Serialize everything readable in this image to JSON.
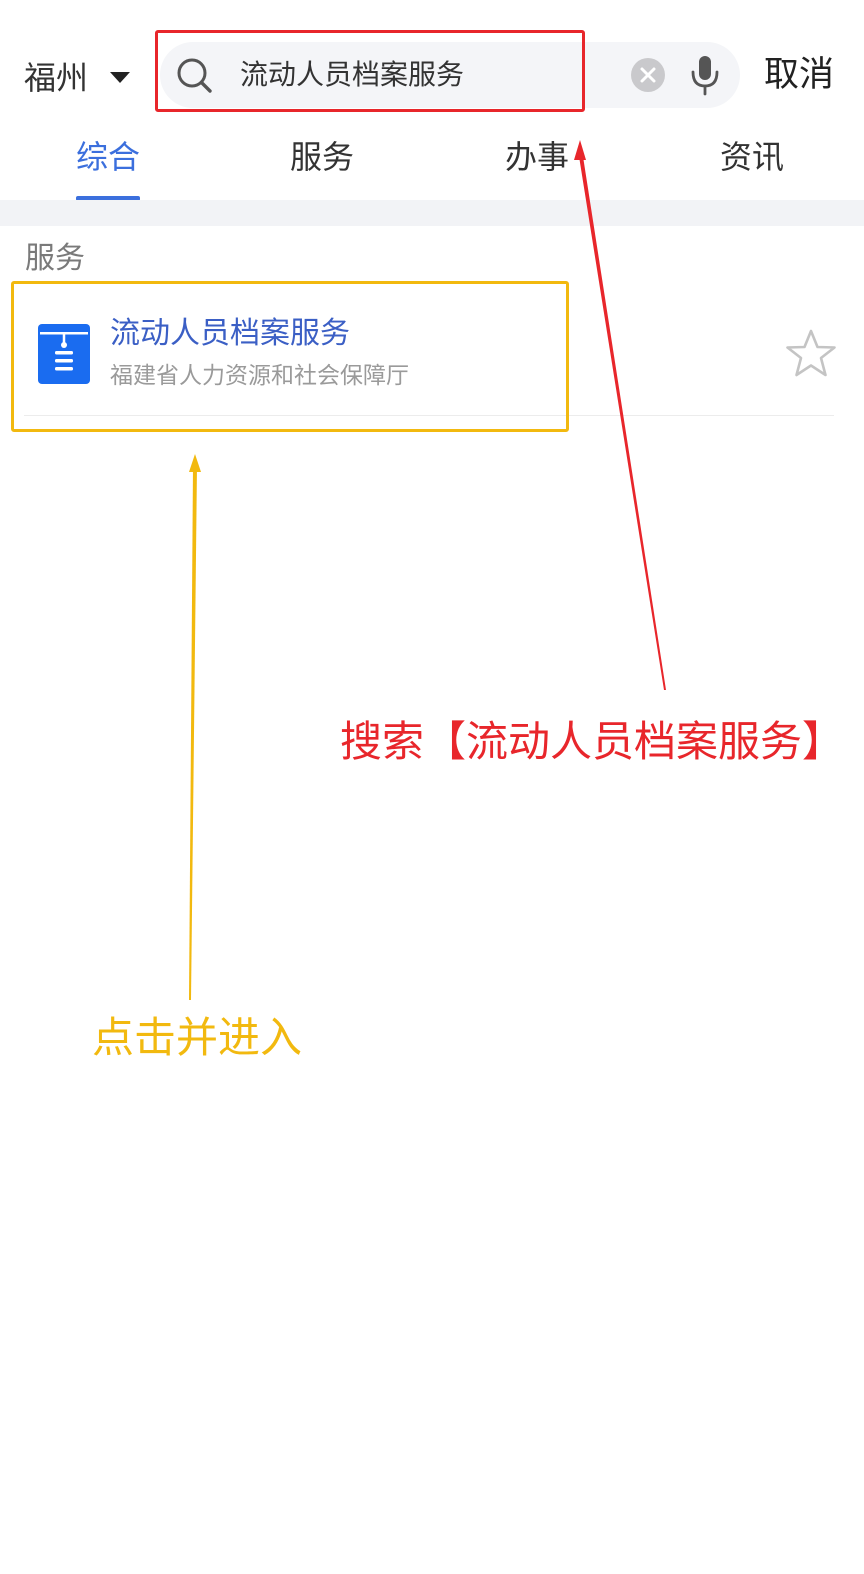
{
  "header": {
    "city": "福州",
    "search": {
      "query": "流动人员档案服务"
    },
    "cancel_label": "取消"
  },
  "tabs": [
    {
      "label": "综合",
      "active": true
    },
    {
      "label": "服务",
      "active": false
    },
    {
      "label": "办事",
      "active": false
    },
    {
      "label": "资讯",
      "active": false
    }
  ],
  "results": {
    "section_title": "服务",
    "items": [
      {
        "title": "流动人员档案服务",
        "subtitle": "福建省人力资源和社会保障厅",
        "icon": "archive-box-icon",
        "favorite_icon": "star-outline-icon"
      }
    ]
  },
  "annotations": {
    "search_hint": "搜索【流动人员档案服务】",
    "click_hint": "点击并进入",
    "colors": {
      "red": "#e8262b",
      "yellow": "#f2b90f"
    }
  },
  "colors": {
    "accent": "#3b6fdd",
    "link": "#3b5fc5",
    "icon_blue": "#1a6cf0"
  }
}
